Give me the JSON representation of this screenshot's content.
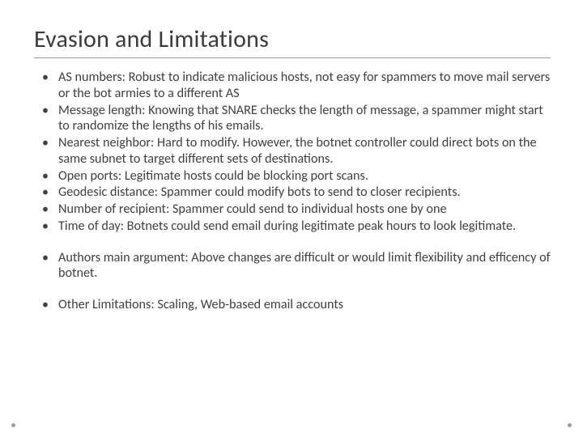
{
  "title": "Evasion and Limitations",
  "group1": [
    "AS numbers: Robust to indicate malicious hosts, not easy for spammers to move mail servers or the bot armies to a different AS",
    "Message length: Knowing that SNARE checks the length of message, a spammer might start to randomize the lengths of his emails.",
    "Nearest neighbor: Hard to modify. However, the botnet controller could direct bots on the same subnet to target different sets of destinations.",
    "Open ports: Legitimate hosts could be blocking port scans.",
    "Geodesic distance: Spammer could modify bots to send to closer recipients.",
    "Number of recipient: Spammer could send to individual hosts one by one",
    "Time of day: Botnets could send email during legitimate peak hours to look legitimate."
  ],
  "group2": [
    "Authors main argument: Above changes are difficult or would limit flexibility and efficency of botnet."
  ],
  "group3": [
    "Other Limitations:  Scaling, Web-based email accounts"
  ]
}
